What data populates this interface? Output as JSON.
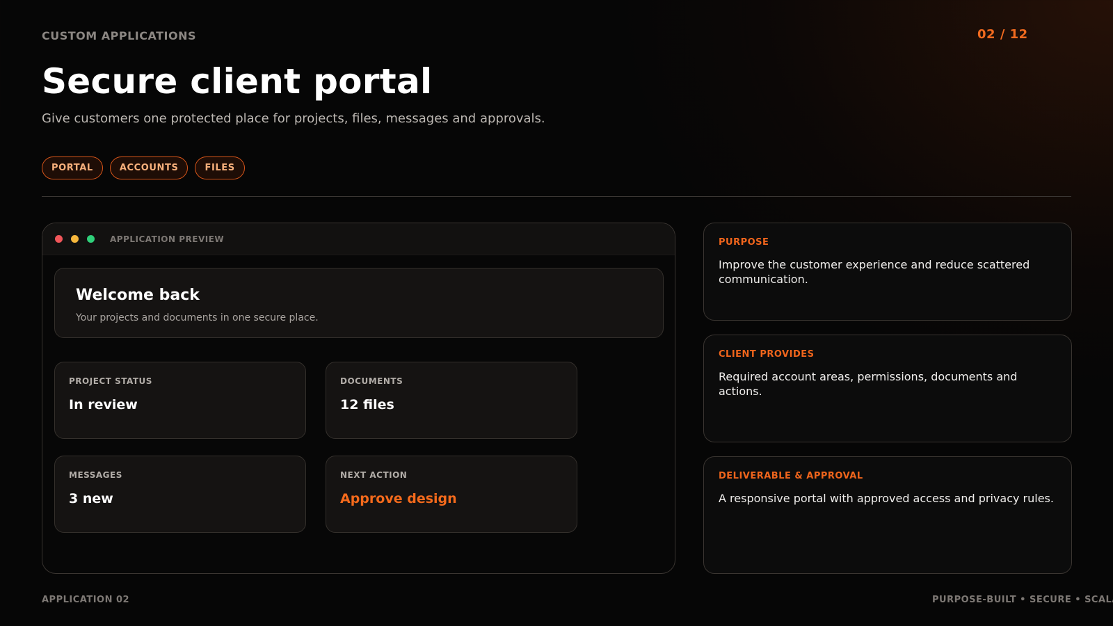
{
  "header": {
    "eyebrow": "CUSTOM APPLICATIONS",
    "page_indicator": "02 / 12",
    "title": "Secure client portal",
    "subtitle": "Give customers one protected place for projects, files, messages and approvals."
  },
  "tags": [
    "PORTAL",
    "ACCOUNTS",
    "FILES"
  ],
  "preview": {
    "label": "APPLICATION PREVIEW",
    "window_dots": [
      "red-dot-icon",
      "yellow-dot-icon",
      "green-dot-icon"
    ],
    "welcome": {
      "heading": "Welcome back",
      "text": "Your projects and documents in one secure place."
    },
    "stats": [
      {
        "label": "PROJECT STATUS",
        "value": "In review"
      },
      {
        "label": "DOCUMENTS",
        "value": "12 files"
      },
      {
        "label": "MESSAGES",
        "value": "3 new"
      },
      {
        "label": "NEXT ACTION",
        "value": "Approve design"
      }
    ]
  },
  "cards": [
    {
      "label": "PURPOSE",
      "text": "Improve the customer experience and reduce scattered communication."
    },
    {
      "label": "CLIENT PROVIDES",
      "text": "Required account areas, permissions, documents and actions."
    },
    {
      "label": "DELIVERABLE & APPROVAL",
      "text": "A responsive portal with approved access and privacy rules."
    }
  ],
  "footer": {
    "left": "APPLICATION 02",
    "right": "PURPOSE-BUILT • SECURE • SCALABLE"
  },
  "colors": {
    "accent": "#f06a1f",
    "background": "#060606",
    "card_background": "#151312"
  }
}
